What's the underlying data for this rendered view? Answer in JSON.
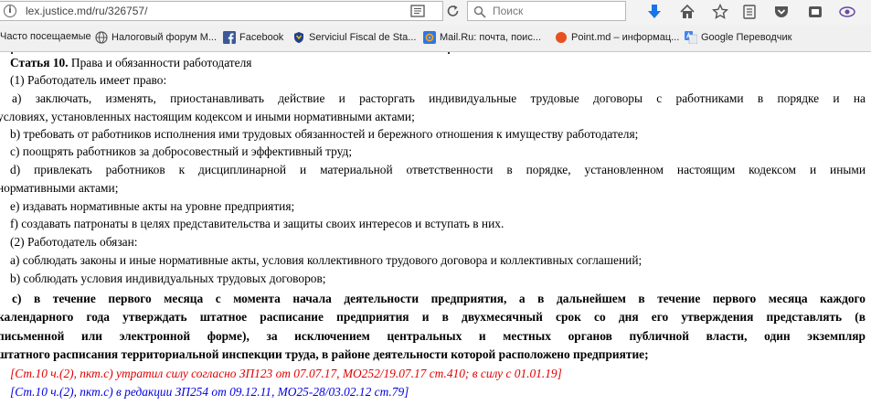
{
  "browser": {
    "url": "lex.justice.md/ru/326757/",
    "search_placeholder": "Поиск",
    "bookmarks": [
      {
        "label": "Часто посещаемые",
        "icon": "none"
      },
      {
        "label": "Налоговый форум М...",
        "icon": "globe-icon"
      },
      {
        "label": "Facebook",
        "icon": "facebook-icon"
      },
      {
        "label": "Serviciul Fiscal de Sta...",
        "icon": "emblem-icon"
      },
      {
        "label": "Mail.Ru: почта, поис...",
        "icon": "mailru-icon"
      },
      {
        "label": "Point.md – информац...",
        "icon": "point-icon"
      },
      {
        "label": "Google Переводчик",
        "icon": "google-translate-icon"
      }
    ],
    "colors": {
      "toolbar_bg": "#f3f3f3",
      "download_icon": "#1a73e8",
      "facebook": "#3b5998",
      "point": "#e8501f"
    }
  },
  "doc": {
    "article_title": "Статья 10.",
    "article_subtitle": " Права и обязанности работодателя",
    "p1_head": "(1) Работодатель имеет право:",
    "a1_l1": "a) заключать, изменять, приостанавливать действие и расторгать индивидуальные трудовые договоры с работниками в порядке и на",
    "a1_l2": "условиях, установленных настоящим кодексом и иными нормативными актами;",
    "b1": "b) требовать от работников исполнения ими трудовых обязанностей и бережного отношения к имуществу работодателя;",
    "c1": "c) поощрять работников за добросовестный и эффективный труд;",
    "d1_l1": "d) привлекать работников к дисциплинарной и материальной ответственности в порядке, установленном настоящим кодексом и иными",
    "d1_l2": "нормативными актами;",
    "e1": "e) издавать нормативные акты на уровне предприятия;",
    "f1": "f) создавать патронаты в целях представительства и защиты своих интересов и вступать в них.",
    "p2_head": "(2) Работодатель обязан:",
    "a2": "a) соблюдать законы и иные нормативные акты, условия коллективного трудового договора и коллективных соглашений;",
    "b2": "b) соблюдать условия индивидуальных трудовых договоров;",
    "c2_l1": "c) в течение первого месяца с момента начала деятельности предприятия, а в дальнейшем в течение первого месяца каждого",
    "c2_l2": "календарного года утверждать штатное расписание предприятия и в двухмесячный срок со дня его утверждения представлять (в",
    "c2_l3": "письменной или электронной форме), за исключением центральных и местных органов публичной власти, один экземпляр",
    "c2_l4": "штатного расписания территориальной инспекции труда, в районе деятельности которой расположено предприятие;",
    "note_red": "[Ст.10 ч.(2), пкт.c) утратил силу согласно ЗП123 от 07.07.17, МО252/19.07.17 ст.410; в силу с 01.01.19]",
    "note_blue": "[Ст.10 ч.(2), пкт.c) в редакции ЗП254 от 09.12.11, МО25-28/03.02.12 ст.79]"
  }
}
